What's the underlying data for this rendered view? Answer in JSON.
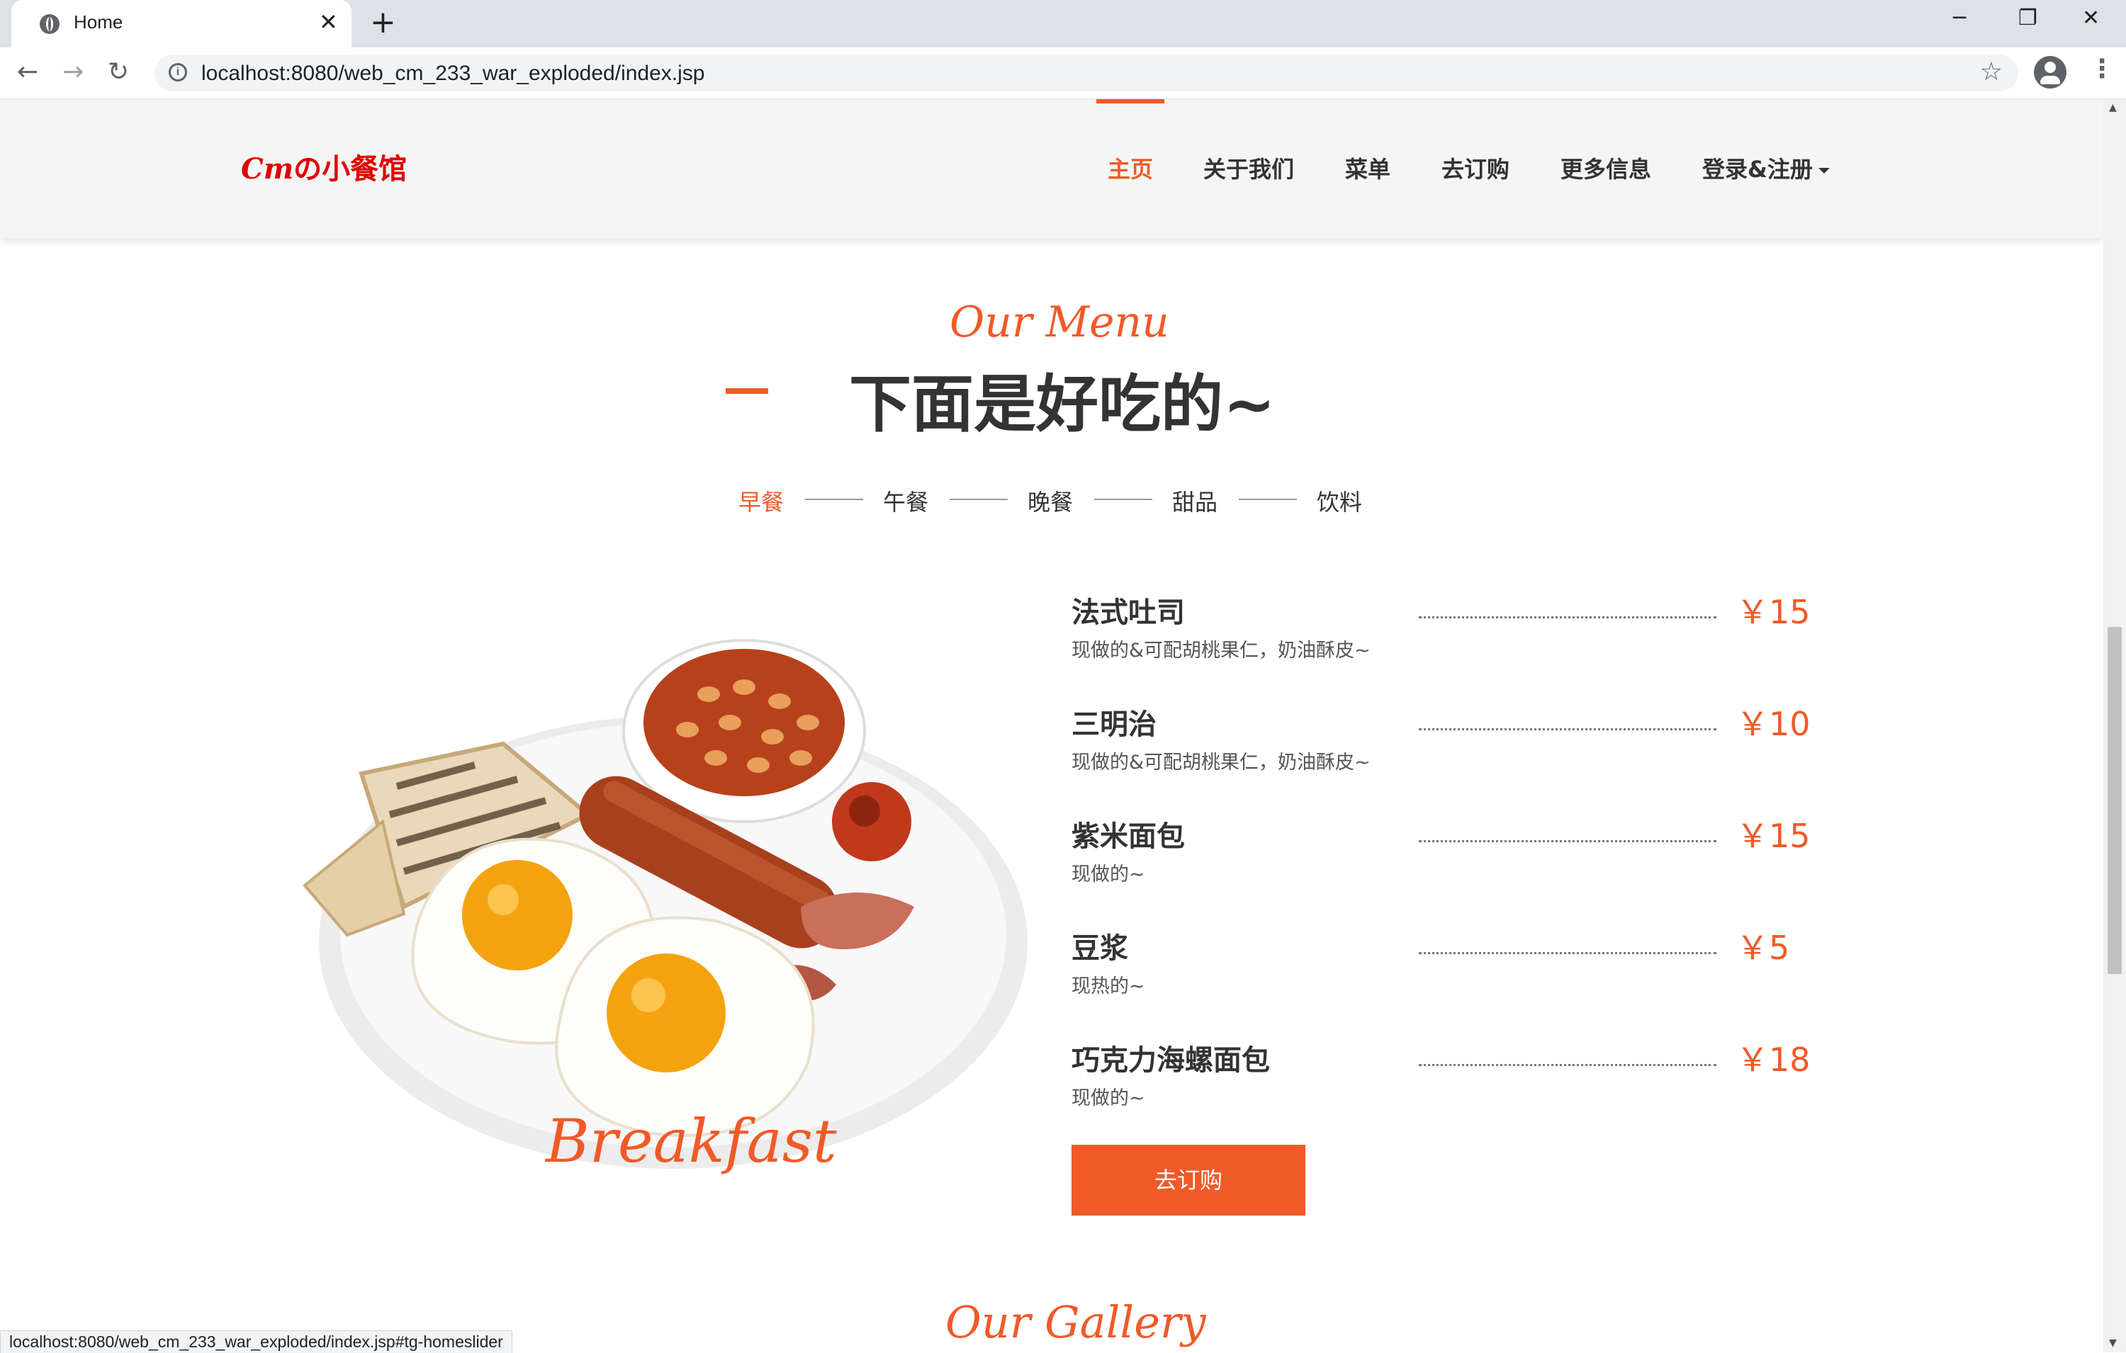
{
  "browser": {
    "tab_title": "Home",
    "tab_close": "✕",
    "new_tab": "+",
    "url": "localhost:8080/web_cm_233_war_exploded/index.jsp",
    "status_url": "localhost:8080/web_cm_233_war_exploded/index.jsp#tg-homeslider",
    "icons": {
      "back": "←",
      "forward": "→",
      "reload": "↻",
      "info": "i",
      "star": "☆",
      "minimize": "─",
      "restore": "❐",
      "close": "✕",
      "menu": "⋮"
    }
  },
  "header": {
    "logo_cm": "Cm",
    "logo_text": "の小餐馆",
    "nav": [
      "主页",
      "关于我们",
      "菜单",
      "去订购",
      "更多信息",
      "登录&注册"
    ],
    "active_nav": "主页"
  },
  "menu_section": {
    "subtitle": "Our Menu",
    "title": "下面是好吃的~",
    "categories": [
      "早餐",
      "午餐",
      "晚餐",
      "甜品",
      "饮料"
    ],
    "active_category": "早餐",
    "image_caption": "Breakfast",
    "items": [
      {
        "name": "法式吐司",
        "desc": "现做的&可配胡桃果仁，奶油酥皮~",
        "price": "￥15"
      },
      {
        "name": "三明治",
        "desc": "现做的&可配胡桃果仁，奶油酥皮~",
        "price": "￥10"
      },
      {
        "name": "紫米面包",
        "desc": "现做的~",
        "price": "￥15"
      },
      {
        "name": "豆浆",
        "desc": "现热的~",
        "price": "￥5"
      },
      {
        "name": "巧克力海螺面包",
        "desc": "现做的~",
        "price": "￥18"
      }
    ],
    "order_button": "去订购"
  },
  "gallery_section": {
    "subtitle": "Our Gallery"
  },
  "colors": {
    "accent": "#f05a28",
    "logo": "#e00000",
    "text": "#333333"
  }
}
